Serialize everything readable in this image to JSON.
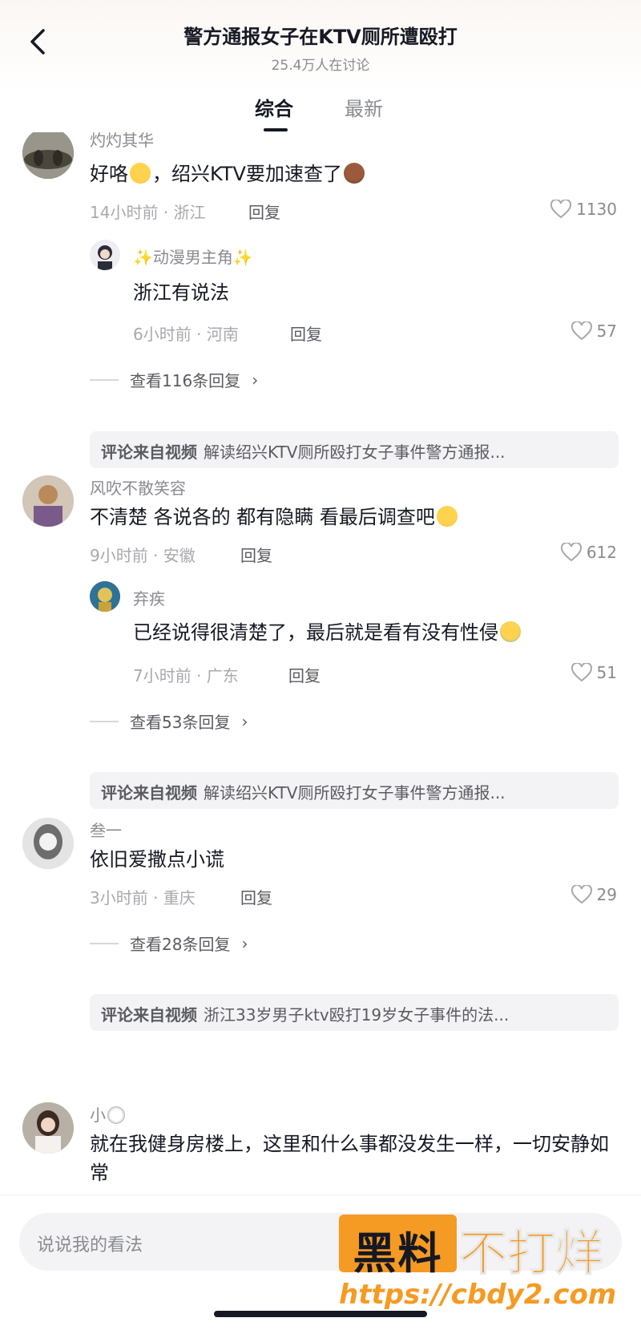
{
  "header": {
    "back_icon": "chevron-left-icon",
    "title": "警方通报女子在KTV厕所遭殴打",
    "subtitle": "25.4万人在讨论"
  },
  "tabs": [
    {
      "label": "综合",
      "active": true
    },
    {
      "label": "最新",
      "active": false
    }
  ],
  "comments": [
    {
      "username": "灼灼其华",
      "text": "好咯",
      "text2": "，绍兴KTV要加速查了",
      "time_location": "14小时前 · 浙江",
      "reply_label": "回复",
      "likes": "1130",
      "sub_reply": {
        "username": "✨动漫男主角✨",
        "text": "浙江有说法",
        "time_location": "6小时前 · 河南",
        "reply_label": "回复",
        "likes": "57"
      },
      "view_replies": "查看116条回复",
      "source_label": "评论来自视频",
      "source_title": "解读绍兴KTV厕所殴打女子事件警方通报..."
    },
    {
      "username": "风吹不散笑容",
      "text": "不清楚 各说各的 都有隐瞒 看最后调查吧",
      "time_location": "9小时前 · 安徽",
      "reply_label": "回复",
      "likes": "612",
      "sub_reply": {
        "username": "弃疾",
        "text": "已经说得很清楚了，最后就是看有没有性侵",
        "time_location": "7小时前 · 广东",
        "reply_label": "回复",
        "likes": "51"
      },
      "view_replies": "查看53条回复",
      "source_label": "评论来自视频",
      "source_title": "解读绍兴KTV厕所殴打女子事件警方通报..."
    },
    {
      "username": "叁一",
      "text": "依旧爱撒点小谎",
      "time_location": "3小时前 · 重庆",
      "reply_label": "回复",
      "likes": "29",
      "view_replies": "查看28条回复",
      "source_label": "评论来自视频",
      "source_title": "浙江33岁男子ktv殴打19岁女子事件的法..."
    },
    {
      "username": "小",
      "text": "就在我健身房楼上，这里和什么事都没发生一样，一切安静如常"
    }
  ],
  "composer": {
    "placeholder": "说说我的看法"
  },
  "watermark": {
    "box_text": "黑料",
    "text": "不打烊",
    "url": "https://cbdy2.com"
  },
  "colors": {
    "primary_text": "#161823",
    "secondary_text": "#8a8b91",
    "source_bg": "#f3f3f5",
    "watermark_orange": "#f59a23"
  }
}
